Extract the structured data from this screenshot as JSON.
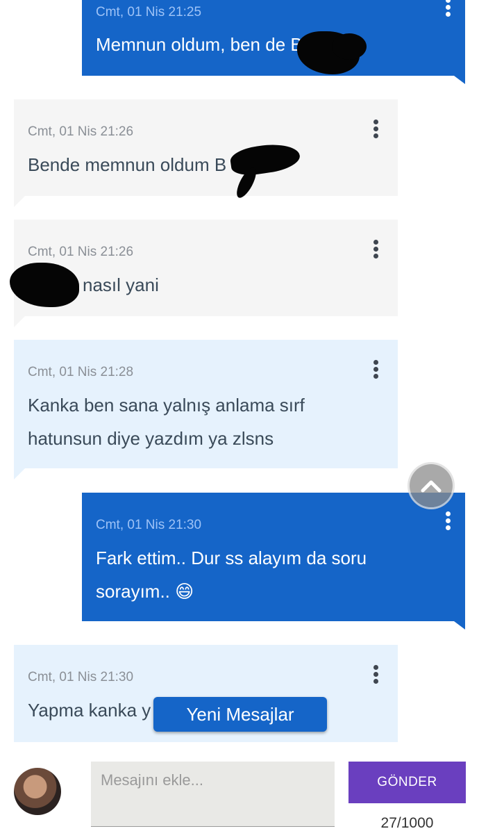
{
  "messages": [
    {
      "direction": "out",
      "timestamp": "Cmt, 01 Nis 21:25",
      "text": "Memnun oldum, ben de B"
    },
    {
      "direction": "in",
      "style": "gray",
      "timestamp": "Cmt, 01 Nis 21:26",
      "text": "Bende memnun oldum B"
    },
    {
      "direction": "in",
      "style": "gray",
      "timestamp": "Cmt, 01 Nis 21:26",
      "text": "nasıl yani"
    },
    {
      "direction": "in",
      "style": "light-blue",
      "timestamp": "Cmt, 01 Nis 21:28",
      "text": "Kanka ben sana yalnış anlama sırf hatunsun diye yazdım ya zlsns"
    },
    {
      "direction": "out",
      "timestamp": "Cmt, 01 Nis 21:30",
      "text": "Fark ettim.. Dur ss alayım da soru sorayım.. 😄"
    },
    {
      "direction": "in",
      "style": "light-blue",
      "timestamp": "Cmt, 01 Nis 21:30",
      "text": "Yapma kanka y"
    }
  ],
  "new_messages_button": "Yeni Mesajlar",
  "composer": {
    "placeholder": "Mesajını ekle...",
    "send_label": "GÖNDER",
    "counter": "27/1000"
  },
  "colors": {
    "outgoing": "#1565c8",
    "incoming_gray": "#f5f5f5",
    "incoming_blue": "#e6f2fd",
    "send_button": "#6a3fbf"
  },
  "icons": {
    "menu": "vertical-ellipsis",
    "scroll_top": "chevron-up"
  }
}
